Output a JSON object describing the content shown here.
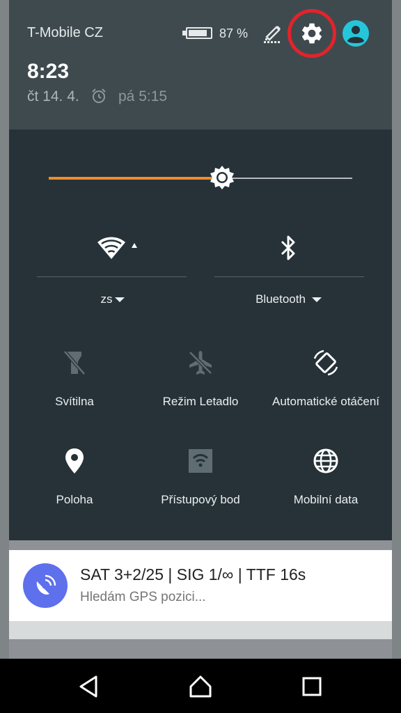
{
  "status": {
    "carrier": "T-Mobile CZ",
    "battery_percent": "87 %",
    "time": "8:23",
    "date": "čt 14. 4.",
    "alarm": "pá 5:15"
  },
  "brightness": {
    "level": 0.57,
    "accent": "#ef8c2a"
  },
  "toggles": {
    "wifi_label": "zs",
    "bluetooth_label": "Bluetooth"
  },
  "tiles": [
    {
      "label": "Svítilna",
      "icon": "flashlight-off-icon"
    },
    {
      "label": "Režim Letadlo",
      "icon": "airplane-mode-off-icon"
    },
    {
      "label": "Automatické otáčení",
      "icon": "auto-rotate-icon"
    },
    {
      "label": "Poloha",
      "icon": "location-icon"
    },
    {
      "label": "Přístupový bod",
      "icon": "hotspot-icon"
    },
    {
      "label": "Mobilní data",
      "icon": "mobile-data-icon"
    }
  ],
  "notification": {
    "title": "SAT 3+2/25 | SIG 1/∞ | TTF 16s",
    "subtitle": "Hledám GPS pozici...",
    "icon": "satellite-dish-icon",
    "color": "#5e70ec"
  },
  "highlight_color": "#e3232a"
}
